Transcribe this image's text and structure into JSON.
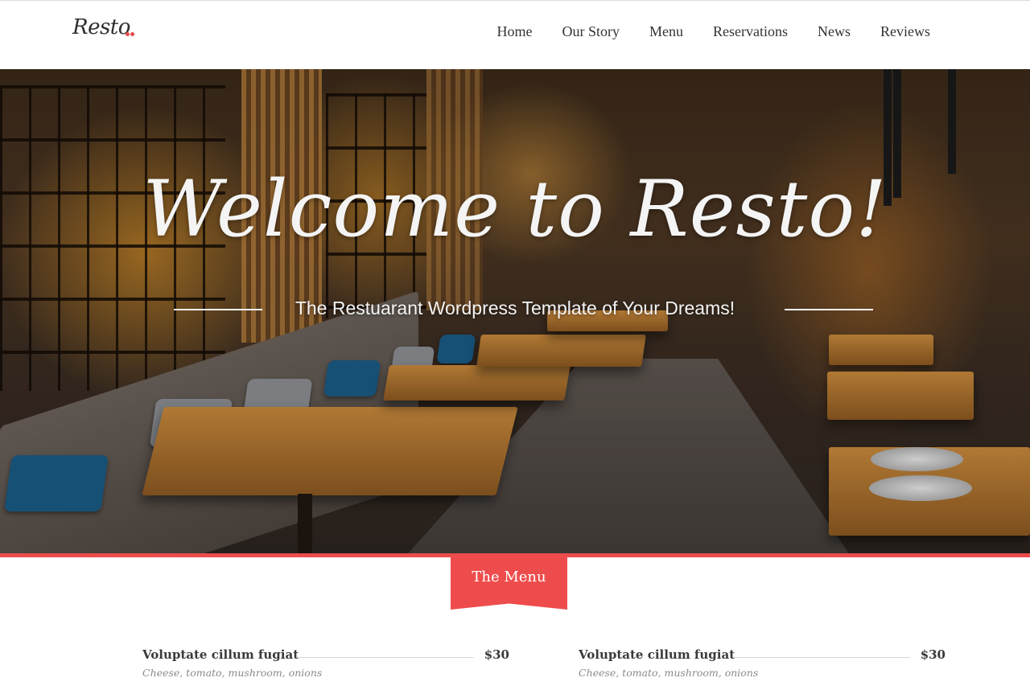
{
  "header": {
    "logo": "Resto",
    "nav": [
      "Home",
      "Our Story",
      "Menu",
      "Reservations",
      "News",
      "Reviews"
    ]
  },
  "hero": {
    "title": "Welcome to Resto!",
    "subtitle": "The Restuarant Wordpress Template of Your Dreams!"
  },
  "menu_section": {
    "ribbon_label": "The Menu",
    "items": [
      {
        "name": "Voluptate cillum fugiat",
        "price": "$30",
        "description": "Cheese, tomato, mushroom, onions"
      },
      {
        "name": "Voluptate cillum fugiat",
        "price": "$30",
        "description": "Cheese, tomato, mushroom, onions"
      }
    ]
  },
  "colors": {
    "accent": "#ee4c4c",
    "text": "#333333",
    "muted": "#8a8a8a"
  }
}
